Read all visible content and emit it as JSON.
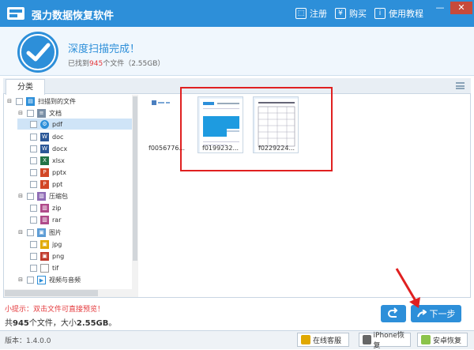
{
  "app": {
    "title": "强力数据恢复软件"
  },
  "toolbar": {
    "register": "注册",
    "buy": "购买",
    "tutorial": "使用教程"
  },
  "status": {
    "title": "深度扫描完成！",
    "sub_prefix": "已找到",
    "count": "945",
    "sub_suffix": "个文件（2.55GB）"
  },
  "tabs": {
    "category": "分类"
  },
  "tree": {
    "root": "扫描到的文件",
    "documents": "文档",
    "pdf": "pdf",
    "doc": "doc",
    "docx": "docx",
    "xlsx": "xlsx",
    "pptx": "pptx",
    "ppt": "ppt",
    "archives": "压缩包",
    "zip": "zip",
    "rar": "rar",
    "images": "图片",
    "jpg": "jpg",
    "png": "png",
    "tif": "tif",
    "media": "视频与音频"
  },
  "files": {
    "item1": "f0056776...",
    "item2": "f0199232...",
    "item3": "f0229224..."
  },
  "footer": {
    "tip": "小提示：双击文件可直接预览！",
    "summary_prefix": "共",
    "count": "945",
    "summary_mid": "个文件，大小",
    "size": "2.55GB",
    "summary_suffix": "。",
    "next": "下一步"
  },
  "statusbar": {
    "version": "版本：1.4.0.0",
    "online_service": "在线客服",
    "iphone_recovery": "iPhone恢复",
    "android_recovery": "安卓恢复"
  },
  "colors": {
    "accent": "#2d8fd9",
    "alert": "#e4393c",
    "highlight": "#e02020"
  }
}
